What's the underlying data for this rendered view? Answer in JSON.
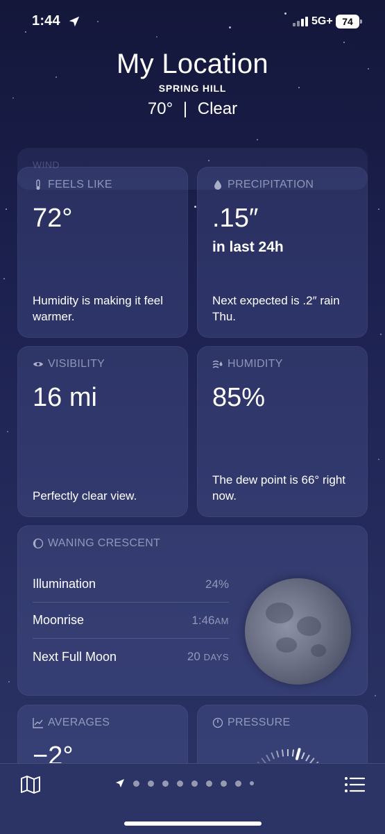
{
  "status_bar": {
    "time": "1:44",
    "network": "5G+",
    "battery": "74"
  },
  "header": {
    "title": "My Location",
    "subtitle": "SPRING HILL",
    "temperature": "70°",
    "separator": "|",
    "condition": "Clear"
  },
  "ghost_card": {
    "label": "WIND"
  },
  "feels_like": {
    "label": "FEELS LIKE",
    "value": "72°",
    "description": "Humidity is making it feel warmer."
  },
  "precipitation": {
    "label": "PRECIPITATION",
    "value": ".15″",
    "period": "in last 24h",
    "description": "Next expected is .2″ rain Thu."
  },
  "visibility": {
    "label": "VISIBILITY",
    "value": "16 mi",
    "description": "Perfectly clear view."
  },
  "humidity": {
    "label": "HUMIDITY",
    "value": "85%",
    "description": "The dew point is 66° right now."
  },
  "moon": {
    "label": "WANING CRESCENT",
    "rows": [
      {
        "key": "Illumination",
        "value": "24%",
        "unit": ""
      },
      {
        "key": "Moonrise",
        "value": "1:46",
        "unit": "AM"
      },
      {
        "key": "Next Full Moon",
        "value": "20",
        "unit": "DAYS"
      }
    ]
  },
  "averages": {
    "label": "AVERAGES",
    "value": "−2°"
  },
  "pressure": {
    "label": "PRESSURE"
  },
  "toolbar": {
    "page_count": 9,
    "current_page": 0
  },
  "colors": {
    "background_top": "#14173a",
    "background_bottom": "#2b3465",
    "card": "#3b4272",
    "label_muted": "#a9aecb"
  }
}
